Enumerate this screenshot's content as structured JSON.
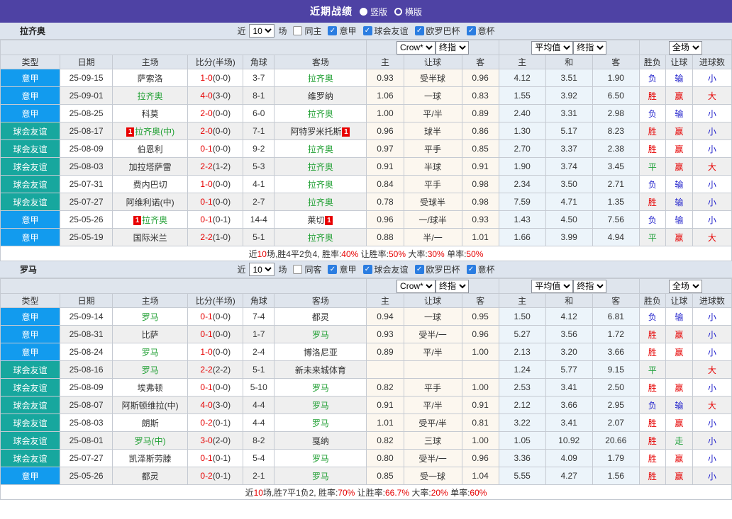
{
  "topbar": {
    "title": "近期战绩",
    "options": [
      {
        "label": "竖版",
        "selected": true
      },
      {
        "label": "横版",
        "selected": false
      }
    ]
  },
  "filter": {
    "near": "近",
    "matches_count": "10",
    "unit": "场",
    "leagues": [
      "意甲",
      "球会友谊",
      "欧罗巴杯",
      "意杯"
    ]
  },
  "selects": {
    "bookmaker": "Crow*",
    "final_a": "终指",
    "average": "平均值",
    "final_b": "终指",
    "scope": "全场"
  },
  "columns": {
    "type": "类型",
    "date": "日期",
    "home": "主场",
    "score": "比分(半场)",
    "corner": "角球",
    "away": "客场",
    "asia_home": "主",
    "asia_handicap": "让球",
    "asia_away": "客",
    "euro_home": "主",
    "euro_draw": "和",
    "euro_away": "客",
    "result": "胜负",
    "handicap_result": "让球",
    "goals": "进球数"
  },
  "type_colors": {
    "意甲": "#129bee",
    "球会友谊": "#17a79e"
  },
  "value_colors": {
    "胜": "r",
    "负": "b",
    "平": "g",
    "赢": "r",
    "输": "b",
    "走": "g",
    "大": "r",
    "小": "b"
  },
  "sections": [
    {
      "team": "拉齐奥",
      "same_label": "同主",
      "rows": [
        {
          "type": "意甲",
          "date": "25-09-15",
          "home": "萨索洛",
          "score": "1-0",
          "half": "(0-0)",
          "corner": "3-7",
          "away": "拉齐奥",
          "asia": [
            "0.93",
            "受半球",
            "0.96"
          ],
          "euro": [
            "4.12",
            "3.51",
            "1.90"
          ],
          "outcome": [
            "负",
            "输",
            "小"
          ]
        },
        {
          "type": "意甲",
          "date": "25-09-01",
          "home": "拉齐奥",
          "score": "4-0",
          "half": "(3-0)",
          "corner": "8-1",
          "away": "维罗纳",
          "asia": [
            "1.06",
            "一球",
            "0.83"
          ],
          "euro": [
            "1.55",
            "3.92",
            "6.50"
          ],
          "outcome": [
            "胜",
            "赢",
            "大"
          ]
        },
        {
          "type": "意甲",
          "date": "25-08-25",
          "home": "科莫",
          "score": "2-0",
          "half": "(0-0)",
          "corner": "6-0",
          "away": "拉齐奥",
          "asia": [
            "1.00",
            "平/半",
            "0.89"
          ],
          "euro": [
            "2.40",
            "3.31",
            "2.98"
          ],
          "outcome": [
            "负",
            "输",
            "小"
          ]
        },
        {
          "type": "球会友谊",
          "date": "25-08-17",
          "home": "拉齐奥(中)",
          "hcard": true,
          "score": "2-0",
          "half": "(0-0)",
          "corner": "7-1",
          "away": "阿特罗米托斯",
          "acard": true,
          "asia": [
            "0.96",
            "球半",
            "0.86"
          ],
          "euro": [
            "1.30",
            "5.17",
            "8.23"
          ],
          "outcome": [
            "胜",
            "赢",
            "小"
          ]
        },
        {
          "type": "球会友谊",
          "date": "25-08-09",
          "home": "伯恩利",
          "score": "0-1",
          "half": "(0-0)",
          "corner": "9-2",
          "away": "拉齐奥",
          "asia": [
            "0.97",
            "平手",
            "0.85"
          ],
          "euro": [
            "2.70",
            "3.37",
            "2.38"
          ],
          "outcome": [
            "胜",
            "赢",
            "小"
          ]
        },
        {
          "type": "球会友谊",
          "date": "25-08-03",
          "home": "加拉塔萨雷",
          "score": "2-2",
          "half": "(1-2)",
          "corner": "5-3",
          "away": "拉齐奥",
          "asia": [
            "0.91",
            "半球",
            "0.91"
          ],
          "euro": [
            "1.90",
            "3.74",
            "3.45"
          ],
          "outcome": [
            "平",
            "赢",
            "大"
          ]
        },
        {
          "type": "球会友谊",
          "date": "25-07-31",
          "home": "费内巴切",
          "score": "1-0",
          "half": "(0-0)",
          "corner": "4-1",
          "away": "拉齐奥",
          "asia": [
            "0.84",
            "平手",
            "0.98"
          ],
          "euro": [
            "2.34",
            "3.50",
            "2.71"
          ],
          "outcome": [
            "负",
            "输",
            "小"
          ]
        },
        {
          "type": "球会友谊",
          "date": "25-07-27",
          "home": "阿维利诺(中)",
          "score": "0-1",
          "half": "(0-0)",
          "corner": "2-7",
          "away": "拉齐奥",
          "asia": [
            "0.78",
            "受球半",
            "0.98"
          ],
          "euro": [
            "7.59",
            "4.71",
            "1.35"
          ],
          "outcome": [
            "胜",
            "输",
            "小"
          ]
        },
        {
          "type": "意甲",
          "date": "25-05-26",
          "home": "拉齐奥",
          "hcard": true,
          "score": "0-1",
          "half": "(0-1)",
          "corner": "14-4",
          "away": "莱切",
          "acard": true,
          "asia": [
            "0.96",
            "一/球半",
            "0.93"
          ],
          "euro": [
            "1.43",
            "4.50",
            "7.56"
          ],
          "outcome": [
            "负",
            "输",
            "小"
          ]
        },
        {
          "type": "意甲",
          "date": "25-05-19",
          "home": "国际米兰",
          "score": "2-2",
          "half": "(1-0)",
          "corner": "5-1",
          "away": "拉齐奥",
          "asia": [
            "0.88",
            "半/一",
            "1.01"
          ],
          "euro": [
            "1.66",
            "3.99",
            "4.94"
          ],
          "outcome": [
            "平",
            "赢",
            "大"
          ]
        }
      ],
      "summary": [
        [
          "近",
          0
        ],
        [
          "10",
          1
        ],
        [
          "场,胜4平2负4, 胜率:",
          0
        ],
        [
          "40%",
          1
        ],
        [
          " 让胜率:",
          0
        ],
        [
          "50%",
          1
        ],
        [
          " 大率:",
          0
        ],
        [
          "30%",
          1
        ],
        [
          " 单率:",
          0
        ],
        [
          "50%",
          1
        ]
      ]
    },
    {
      "team": "罗马",
      "same_label": "同客",
      "rows": [
        {
          "type": "意甲",
          "date": "25-09-14",
          "home": "罗马",
          "score": "0-1",
          "half": "(0-0)",
          "corner": "7-4",
          "away": "都灵",
          "asia": [
            "0.94",
            "一球",
            "0.95"
          ],
          "euro": [
            "1.50",
            "4.12",
            "6.81"
          ],
          "outcome": [
            "负",
            "输",
            "小"
          ]
        },
        {
          "type": "意甲",
          "date": "25-08-31",
          "home": "比萨",
          "score": "0-1",
          "half": "(0-0)",
          "corner": "1-7",
          "away": "罗马",
          "asia": [
            "0.93",
            "受半/一",
            "0.96"
          ],
          "euro": [
            "5.27",
            "3.56",
            "1.72"
          ],
          "outcome": [
            "胜",
            "赢",
            "小"
          ]
        },
        {
          "type": "意甲",
          "date": "25-08-24",
          "home": "罗马",
          "score": "1-0",
          "half": "(0-0)",
          "corner": "2-4",
          "away": "博洛尼亚",
          "asia": [
            "0.89",
            "平/半",
            "1.00"
          ],
          "euro": [
            "2.13",
            "3.20",
            "3.66"
          ],
          "outcome": [
            "胜",
            "赢",
            "小"
          ]
        },
        {
          "type": "球会友谊",
          "date": "25-08-16",
          "home": "罗马",
          "score": "2-2",
          "half": "(2-2)",
          "corner": "5-1",
          "away": "新未来城体育",
          "asia": [
            "",
            "",
            ""
          ],
          "euro": [
            "1.24",
            "5.77",
            "9.15"
          ],
          "outcome": [
            "平",
            "",
            "大"
          ]
        },
        {
          "type": "球会友谊",
          "date": "25-08-09",
          "home": "埃弗顿",
          "score": "0-1",
          "half": "(0-0)",
          "corner": "5-10",
          "away": "罗马",
          "asia": [
            "0.82",
            "平手",
            "1.00"
          ],
          "euro": [
            "2.53",
            "3.41",
            "2.50"
          ],
          "outcome": [
            "胜",
            "赢",
            "小"
          ]
        },
        {
          "type": "球会友谊",
          "date": "25-08-07",
          "home": "阿斯顿维拉(中)",
          "score": "4-0",
          "half": "(3-0)",
          "corner": "4-4",
          "away": "罗马",
          "asia": [
            "0.91",
            "平/半",
            "0.91"
          ],
          "euro": [
            "2.12",
            "3.66",
            "2.95"
          ],
          "outcome": [
            "负",
            "输",
            "大"
          ]
        },
        {
          "type": "球会友谊",
          "date": "25-08-03",
          "home": "朗斯",
          "score": "0-2",
          "half": "(0-1)",
          "corner": "4-4",
          "away": "罗马",
          "asia": [
            "1.01",
            "受平/半",
            "0.81"
          ],
          "euro": [
            "3.22",
            "3.41",
            "2.07"
          ],
          "outcome": [
            "胜",
            "赢",
            "小"
          ]
        },
        {
          "type": "球会友谊",
          "date": "25-08-01",
          "home": "罗马(中)",
          "score": "3-0",
          "half": "(2-0)",
          "corner": "8-2",
          "away": "戛纳",
          "asia": [
            "0.82",
            "三球",
            "1.00"
          ],
          "euro": [
            "1.05",
            "10.92",
            "20.66"
          ],
          "outcome": [
            "胜",
            "走",
            "小"
          ]
        },
        {
          "type": "球会友谊",
          "date": "25-07-27",
          "home": "凯泽斯劳滕",
          "score": "0-1",
          "half": "(0-1)",
          "corner": "5-4",
          "away": "罗马",
          "asia": [
            "0.80",
            "受半/一",
            "0.96"
          ],
          "euro": [
            "3.36",
            "4.09",
            "1.79"
          ],
          "outcome": [
            "胜",
            "赢",
            "小"
          ]
        },
        {
          "type": "意甲",
          "date": "25-05-26",
          "home": "都灵",
          "score": "0-2",
          "half": "(0-1)",
          "corner": "2-1",
          "away": "罗马",
          "asia": [
            "0.85",
            "受一球",
            "1.04"
          ],
          "euro": [
            "5.55",
            "4.27",
            "1.56"
          ],
          "outcome": [
            "胜",
            "赢",
            "小"
          ]
        }
      ],
      "summary": [
        [
          "近",
          0
        ],
        [
          "10",
          1
        ],
        [
          "场,胜7平1负2, 胜率:",
          0
        ],
        [
          "70%",
          1
        ],
        [
          " 让胜率:",
          0
        ],
        [
          "66.7%",
          1
        ],
        [
          " 大率:",
          0
        ],
        [
          "20%",
          1
        ],
        [
          " 单率:",
          0
        ],
        [
          "60%",
          1
        ]
      ]
    }
  ]
}
